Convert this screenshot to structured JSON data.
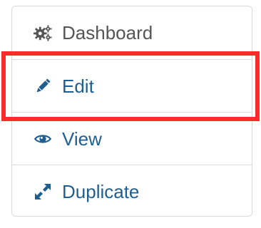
{
  "menu": {
    "items": [
      {
        "label": "Dashboard",
        "icon": "gears-icon"
      },
      {
        "label": "Edit",
        "icon": "pencil-icon"
      },
      {
        "label": "View",
        "icon": "eye-icon"
      },
      {
        "label": "Duplicate",
        "icon": "expand-arrows-icon"
      }
    ]
  },
  "colors": {
    "link": "#1f5f8f",
    "muted": "#555555",
    "highlight": "#ff2a2a",
    "border": "#d9d9d9"
  }
}
